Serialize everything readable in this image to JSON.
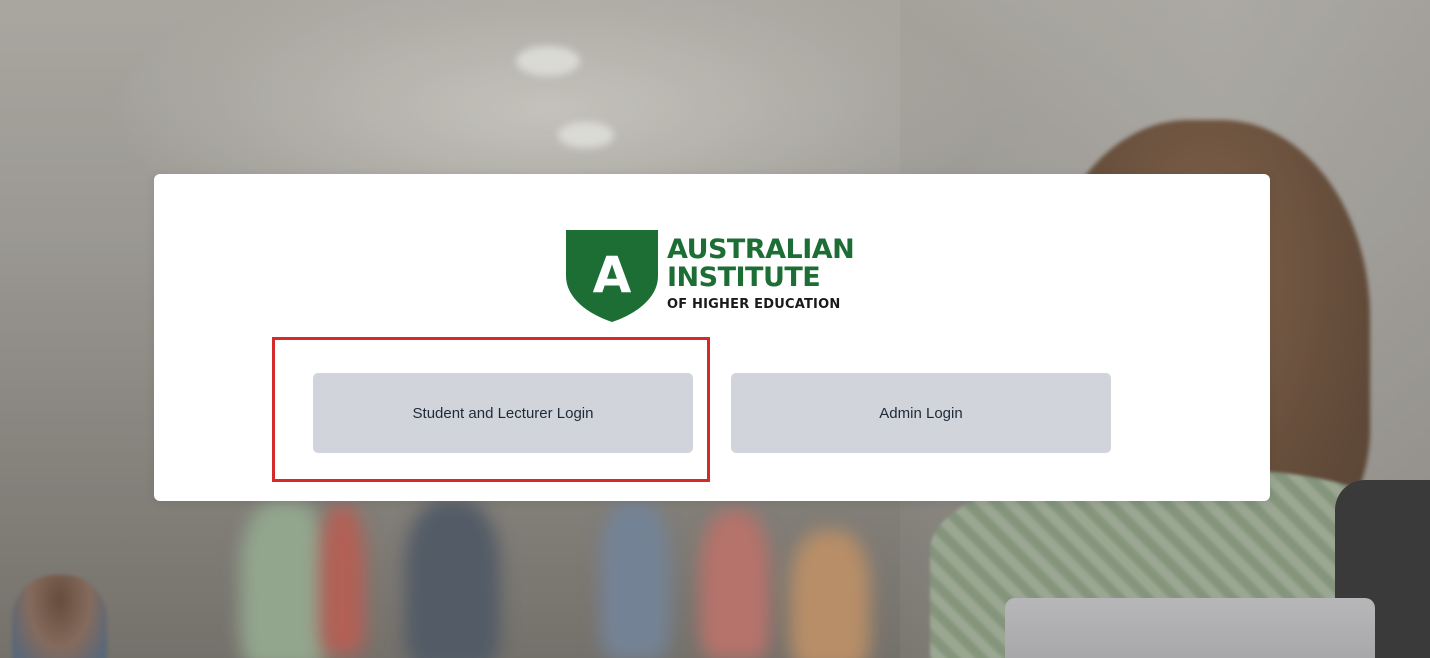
{
  "brand": {
    "name_line1": "AUSTRALIAN",
    "name_line2": "INSTITUTE",
    "name_line3": "OF HIGHER EDUCATION",
    "shield_letter": "A",
    "primary_color": "#1d6e35"
  },
  "login_options": {
    "student_lecturer_label": "Student and Lecturer Login",
    "admin_label": "Admin Login",
    "button_color": "#d1d5db"
  },
  "highlight": {
    "target": "student-and-lecturer-login-button",
    "color": "#d42a2a"
  }
}
